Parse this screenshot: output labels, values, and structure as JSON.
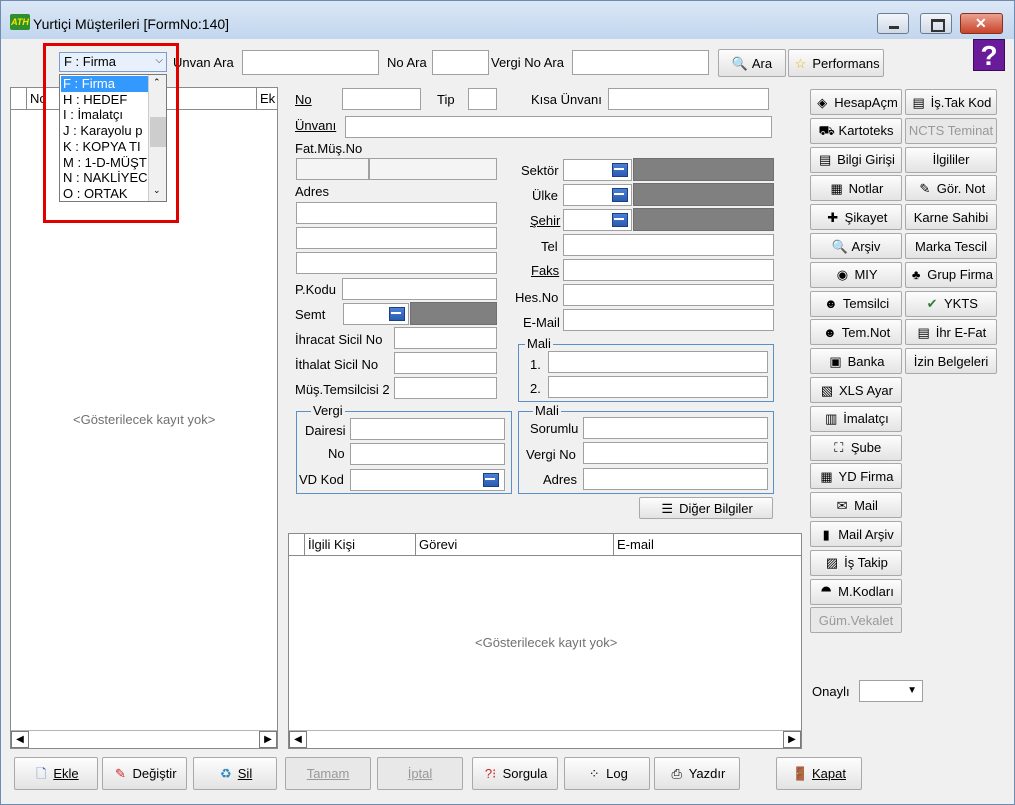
{
  "window": {
    "title": "Yurtiçi Müşterileri [FormNo:140]",
    "app_icon": "ATH"
  },
  "search": {
    "type_selected": "F : Firma",
    "type_options": [
      "F : Firma",
      "H : HEDEF",
      "I : İmalatçı",
      "J : Karayolu p",
      "K : KOPYA TI",
      "M : 1-D-MÜŞT",
      "N : NAKLİYEC",
      "O : ORTAK"
    ],
    "unvan_label": "Unvan Ara",
    "no_label": "No Ara",
    "vergi_label": "Vergi No Ara",
    "ara_button": "Ara",
    "performans_button": "Performans"
  },
  "left_grid": {
    "col_no": "No",
    "col_ek": "Ek",
    "empty": "<Gösterilecek kayıt yok>"
  },
  "form": {
    "no": "No",
    "tip": "Tip",
    "kisa_unvan": "Kısa Ünvanı",
    "unvan": "Ünvanı",
    "fat_mus_no": "Fat.Müş.No",
    "adres": "Adres",
    "sektor": "Sektör",
    "ulke": "Ülke",
    "sehir": "Şehir",
    "tel": "Tel",
    "faks": "Faks",
    "hes_no": "Hes.No",
    "email": "E-Mail",
    "pkodu": "P.Kodu",
    "semt": "Semt",
    "ihracat": "İhracat Sicil No",
    "ithalat": "İthalat Sicil No",
    "mus_temsilcisi": "Müş.Temsilcisi 2"
  },
  "mali_box": {
    "title": "Mali",
    "line1": "1.",
    "line2": "2."
  },
  "vergi_box": {
    "title": "Vergi",
    "dairesi": "Dairesi",
    "no": "No",
    "vd_kod": "VD Kod"
  },
  "mali2_box": {
    "title": "Mali",
    "sorumlu": "Sorumlu",
    "vergi_no": "Vergi No",
    "adres": "Adres"
  },
  "diger_button": "Diğer Bilgiler",
  "contact_grid": {
    "col_kisi": "İlgili Kişi",
    "col_gorevi": "Görevi",
    "col_email": "E-mail",
    "empty": "<Gösterilecek kayıt yok>"
  },
  "side_left": [
    "HesapAçm",
    "Kartoteks",
    "Bilgi Girişi",
    "Notlar",
    "Şikayet",
    "Arşiv",
    "MIY",
    "Temsilci",
    "Tem.Not",
    "Banka",
    "XLS Ayar",
    "İmalatçı",
    "Şube",
    "YD Firma",
    "Mail",
    "Mail Arşiv",
    "İş Takip",
    "M.Kodları",
    "Güm.Vekalet"
  ],
  "side_right": [
    "İş.Tak Kod",
    "NCTS Teminat",
    "İlgililer",
    "Gör. Not",
    "Karne Sahibi",
    "Marka Tescil",
    "Grup Firma",
    "YKTS",
    "İhr E-Fat",
    "İzin Belgeleri"
  ],
  "onayli_label": "Onaylı",
  "bottom": {
    "ekle": "Ekle",
    "degistir": "Değiştir",
    "sil": "Sil",
    "tamam": "Tamam",
    "iptal": "İptal",
    "sorgula": "Sorgula",
    "log": "Log",
    "yazdir": "Yazdır",
    "kapat": "Kapat"
  }
}
